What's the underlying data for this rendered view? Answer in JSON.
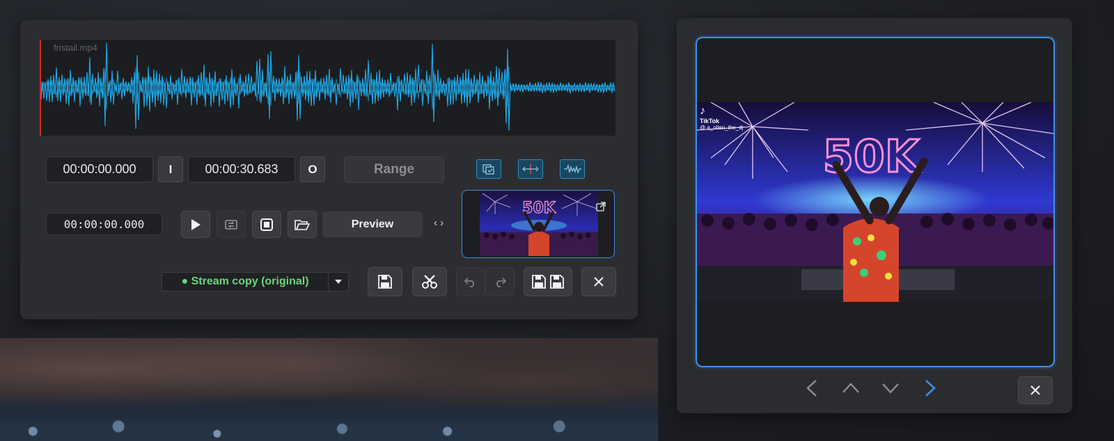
{
  "editor": {
    "filename": "fristail.mp4",
    "in_time": "00:00:00.000",
    "in_marker": "I",
    "out_time": "00:00:30.683",
    "out_marker": "O",
    "range_label": "Range",
    "current_time": "00:00:00.000",
    "preview_label": "Preview",
    "toggle_symbol": "‹ ›",
    "output_mode": "● Stream copy (original)"
  },
  "thumbnail": {
    "overlay_text": "50K"
  },
  "viewer": {
    "overlay_text": "50K",
    "watermark_brand": "TikTok",
    "watermark_user": "@ a_ollen_the_dj"
  },
  "colors": {
    "accent": "#3e8fe8",
    "waveform": "#1fa8e6",
    "stream_copy": "#6cd67a"
  }
}
